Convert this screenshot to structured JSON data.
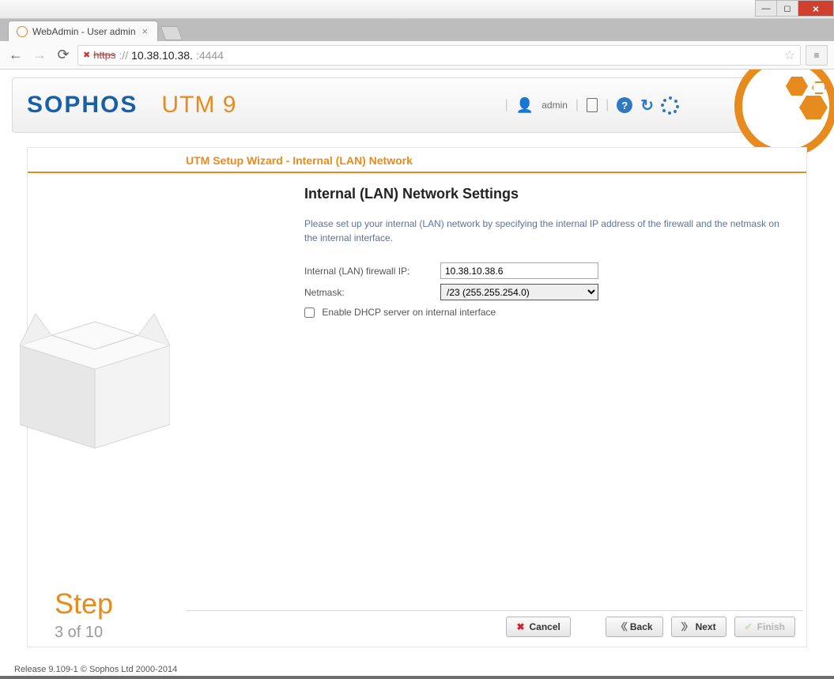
{
  "browser": {
    "tab_title": "WebAdmin - User admin",
    "url_proto": "https",
    "url_host": "10.38.10.38.",
    "url_port": ":4444",
    "url_sep": "://"
  },
  "header": {
    "brand": "SOPHOS",
    "product": "UTM 9",
    "username": "admin"
  },
  "wizard": {
    "title": "UTM Setup Wizard - Internal (LAN) Network",
    "step_word": "Step",
    "step_of": "3 of 10",
    "section_title": "Internal (LAN) Network Settings",
    "section_desc": "Please set up your internal (LAN) network by specifying the internal IP address of the firewall and the netmask on the internal interface.",
    "fields": {
      "firewall_ip_label": "Internal (LAN) firewall IP:",
      "firewall_ip_value": "10.38.10.38.6",
      "netmask_label": "Netmask:",
      "netmask_value": "/23 (255.255.254.0)",
      "dhcp_label": "Enable DHCP server on internal interface",
      "dhcp_checked": false
    },
    "buttons": {
      "cancel": "Cancel",
      "back": "Back",
      "next": "Next",
      "finish": "Finish"
    }
  },
  "footer": {
    "release": "Release 9.109-1  © Sophos Ltd 2000-2014"
  }
}
